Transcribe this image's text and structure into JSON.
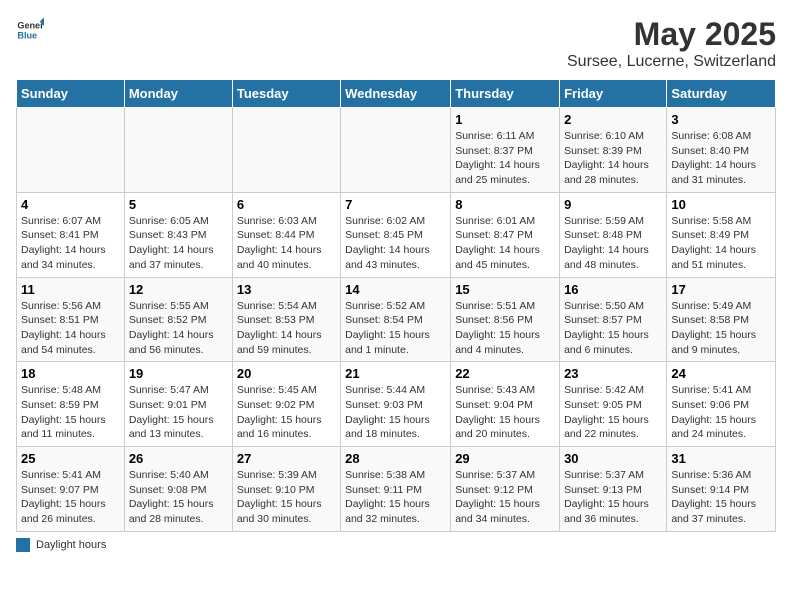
{
  "logo": {
    "general": "General",
    "blue": "Blue"
  },
  "title": "May 2025",
  "subtitle": "Sursee, Lucerne, Switzerland",
  "days_of_week": [
    "Sunday",
    "Monday",
    "Tuesday",
    "Wednesday",
    "Thursday",
    "Friday",
    "Saturday"
  ],
  "legend_label": "Daylight hours",
  "weeks": [
    [
      {
        "day": "",
        "detail": ""
      },
      {
        "day": "",
        "detail": ""
      },
      {
        "day": "",
        "detail": ""
      },
      {
        "day": "",
        "detail": ""
      },
      {
        "day": "1",
        "detail": "Sunrise: 6:11 AM\nSunset: 8:37 PM\nDaylight: 14 hours and 25 minutes."
      },
      {
        "day": "2",
        "detail": "Sunrise: 6:10 AM\nSunset: 8:39 PM\nDaylight: 14 hours and 28 minutes."
      },
      {
        "day": "3",
        "detail": "Sunrise: 6:08 AM\nSunset: 8:40 PM\nDaylight: 14 hours and 31 minutes."
      }
    ],
    [
      {
        "day": "4",
        "detail": "Sunrise: 6:07 AM\nSunset: 8:41 PM\nDaylight: 14 hours and 34 minutes."
      },
      {
        "day": "5",
        "detail": "Sunrise: 6:05 AM\nSunset: 8:43 PM\nDaylight: 14 hours and 37 minutes."
      },
      {
        "day": "6",
        "detail": "Sunrise: 6:03 AM\nSunset: 8:44 PM\nDaylight: 14 hours and 40 minutes."
      },
      {
        "day": "7",
        "detail": "Sunrise: 6:02 AM\nSunset: 8:45 PM\nDaylight: 14 hours and 43 minutes."
      },
      {
        "day": "8",
        "detail": "Sunrise: 6:01 AM\nSunset: 8:47 PM\nDaylight: 14 hours and 45 minutes."
      },
      {
        "day": "9",
        "detail": "Sunrise: 5:59 AM\nSunset: 8:48 PM\nDaylight: 14 hours and 48 minutes."
      },
      {
        "day": "10",
        "detail": "Sunrise: 5:58 AM\nSunset: 8:49 PM\nDaylight: 14 hours and 51 minutes."
      }
    ],
    [
      {
        "day": "11",
        "detail": "Sunrise: 5:56 AM\nSunset: 8:51 PM\nDaylight: 14 hours and 54 minutes."
      },
      {
        "day": "12",
        "detail": "Sunrise: 5:55 AM\nSunset: 8:52 PM\nDaylight: 14 hours and 56 minutes."
      },
      {
        "day": "13",
        "detail": "Sunrise: 5:54 AM\nSunset: 8:53 PM\nDaylight: 14 hours and 59 minutes."
      },
      {
        "day": "14",
        "detail": "Sunrise: 5:52 AM\nSunset: 8:54 PM\nDaylight: 15 hours and 1 minute."
      },
      {
        "day": "15",
        "detail": "Sunrise: 5:51 AM\nSunset: 8:56 PM\nDaylight: 15 hours and 4 minutes."
      },
      {
        "day": "16",
        "detail": "Sunrise: 5:50 AM\nSunset: 8:57 PM\nDaylight: 15 hours and 6 minutes."
      },
      {
        "day": "17",
        "detail": "Sunrise: 5:49 AM\nSunset: 8:58 PM\nDaylight: 15 hours and 9 minutes."
      }
    ],
    [
      {
        "day": "18",
        "detail": "Sunrise: 5:48 AM\nSunset: 8:59 PM\nDaylight: 15 hours and 11 minutes."
      },
      {
        "day": "19",
        "detail": "Sunrise: 5:47 AM\nSunset: 9:01 PM\nDaylight: 15 hours and 13 minutes."
      },
      {
        "day": "20",
        "detail": "Sunrise: 5:45 AM\nSunset: 9:02 PM\nDaylight: 15 hours and 16 minutes."
      },
      {
        "day": "21",
        "detail": "Sunrise: 5:44 AM\nSunset: 9:03 PM\nDaylight: 15 hours and 18 minutes."
      },
      {
        "day": "22",
        "detail": "Sunrise: 5:43 AM\nSunset: 9:04 PM\nDaylight: 15 hours and 20 minutes."
      },
      {
        "day": "23",
        "detail": "Sunrise: 5:42 AM\nSunset: 9:05 PM\nDaylight: 15 hours and 22 minutes."
      },
      {
        "day": "24",
        "detail": "Sunrise: 5:41 AM\nSunset: 9:06 PM\nDaylight: 15 hours and 24 minutes."
      }
    ],
    [
      {
        "day": "25",
        "detail": "Sunrise: 5:41 AM\nSunset: 9:07 PM\nDaylight: 15 hours and 26 minutes."
      },
      {
        "day": "26",
        "detail": "Sunrise: 5:40 AM\nSunset: 9:08 PM\nDaylight: 15 hours and 28 minutes."
      },
      {
        "day": "27",
        "detail": "Sunrise: 5:39 AM\nSunset: 9:10 PM\nDaylight: 15 hours and 30 minutes."
      },
      {
        "day": "28",
        "detail": "Sunrise: 5:38 AM\nSunset: 9:11 PM\nDaylight: 15 hours and 32 minutes."
      },
      {
        "day": "29",
        "detail": "Sunrise: 5:37 AM\nSunset: 9:12 PM\nDaylight: 15 hours and 34 minutes."
      },
      {
        "day": "30",
        "detail": "Sunrise: 5:37 AM\nSunset: 9:13 PM\nDaylight: 15 hours and 36 minutes."
      },
      {
        "day": "31",
        "detail": "Sunrise: 5:36 AM\nSunset: 9:14 PM\nDaylight: 15 hours and 37 minutes."
      }
    ]
  ]
}
